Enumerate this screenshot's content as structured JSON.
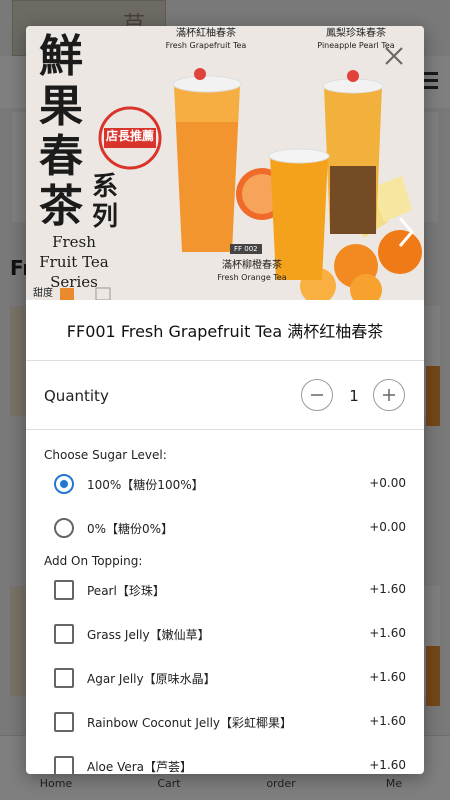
{
  "background": {
    "section_title": "Fr",
    "bottom_nav": [
      "Home",
      "Cart",
      "order",
      "Me"
    ]
  },
  "hero": {
    "vertical_title": "鮮果春茶",
    "vertical_sub": "系列",
    "series_en": "Fresh Fruit Tea Series",
    "stamp_text": "店長推薦",
    "label_grapefruit_cn": "滿杯紅柚春茶",
    "label_grapefruit_en": "Fresh Grapefruit Tea",
    "label_pineapple_cn": "鳳梨珍珠春茶",
    "label_pineapple_en": "Pineapple Pearl Tea",
    "label_orange_cn": "滿杯柳橙春茶",
    "label_orange_en": "Fresh Orange Tea",
    "badge_code": "FF 002",
    "sweetness_label": "甜度"
  },
  "product": {
    "title": "FF001 Fresh Grapefruit Tea 满杯红柚春茶"
  },
  "quantity": {
    "label": "Quantity",
    "value": "1"
  },
  "sugar": {
    "title": "Choose Sugar Level:",
    "options": [
      {
        "label": "100%【糖份100%】",
        "price": "+0.00",
        "checked": true
      },
      {
        "label": "0%【糖份0%】",
        "price": "+0.00",
        "checked": false
      }
    ]
  },
  "topping": {
    "title": "Add On Topping:",
    "options": [
      {
        "label": "Pearl【珍珠】",
        "price": "+1.60"
      },
      {
        "label": "Grass Jelly【嫩仙草】",
        "price": "+1.60"
      },
      {
        "label": "Agar Jelly【原味水晶】",
        "price": "+1.60"
      },
      {
        "label": "Rainbow Coconut Jelly【彩虹椰果】",
        "price": "+1.60"
      },
      {
        "label": "Aloe Vera【芦荟】",
        "price": "+1.60"
      }
    ]
  },
  "colors": {
    "accent": "#2376d1",
    "overlay": "rgba(0,0,0,0.5)"
  }
}
